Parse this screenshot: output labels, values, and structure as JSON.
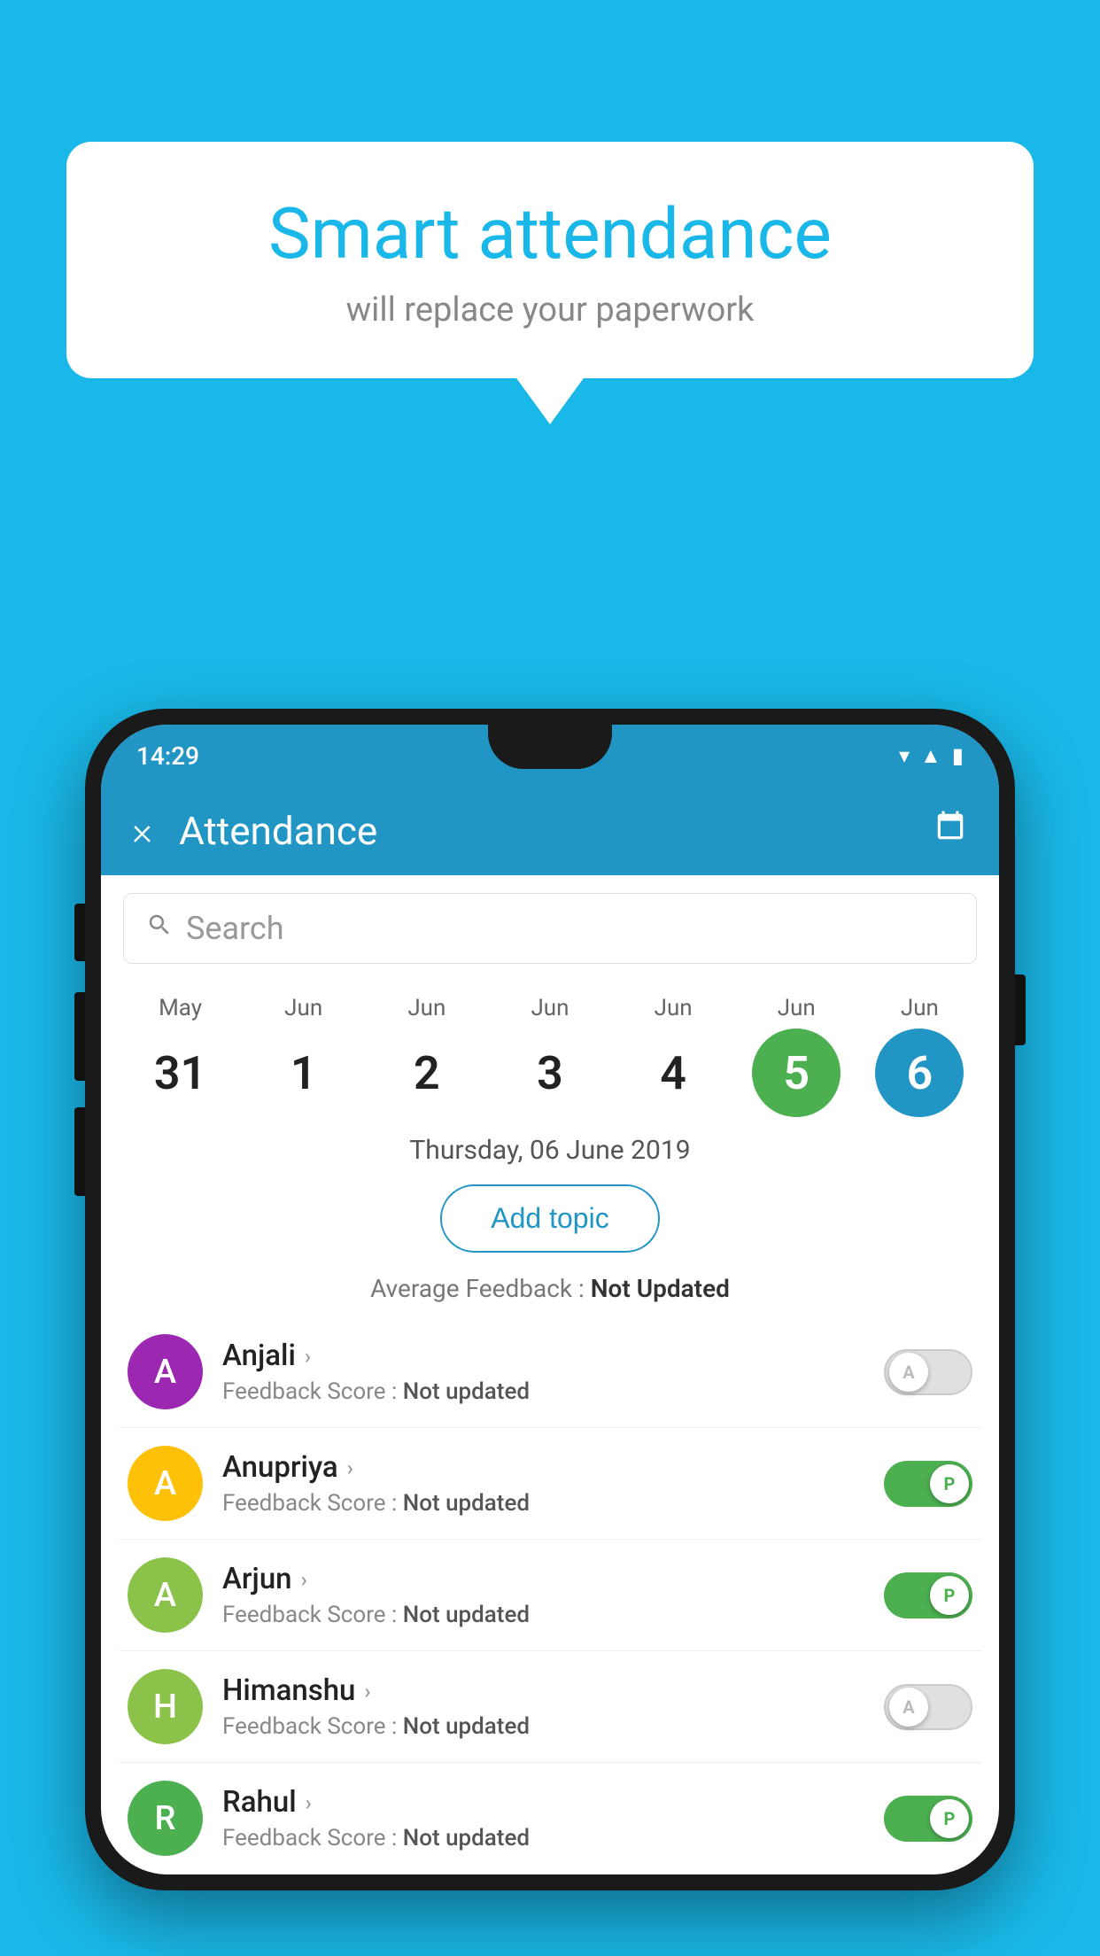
{
  "background_color": "#1ab8e8",
  "bubble": {
    "title": "Smart attendance",
    "subtitle": "will replace your paperwork"
  },
  "status_bar": {
    "time": "14:29",
    "icons": [
      "wifi",
      "signal",
      "battery"
    ]
  },
  "app_bar": {
    "title": "Attendance",
    "close_label": "×",
    "calendar_label": "📅"
  },
  "search": {
    "placeholder": "Search"
  },
  "calendar": {
    "days": [
      {
        "month": "May",
        "date": "31",
        "state": "normal"
      },
      {
        "month": "Jun",
        "date": "1",
        "state": "normal"
      },
      {
        "month": "Jun",
        "date": "2",
        "state": "normal"
      },
      {
        "month": "Jun",
        "date": "3",
        "state": "normal"
      },
      {
        "month": "Jun",
        "date": "4",
        "state": "normal"
      },
      {
        "month": "Jun",
        "date": "5",
        "state": "today"
      },
      {
        "month": "Jun",
        "date": "6",
        "state": "selected"
      }
    ]
  },
  "selected_date_label": "Thursday, 06 June 2019",
  "add_topic_label": "Add topic",
  "avg_feedback_prefix": "Average Feedback : ",
  "avg_feedback_value": "Not Updated",
  "students": [
    {
      "name": "Anjali",
      "avatar_letter": "A",
      "avatar_color": "#9c27b0",
      "feedback_prefix": "Feedback Score : ",
      "feedback_value": "Not updated",
      "toggle_state": "off",
      "toggle_letter": "A"
    },
    {
      "name": "Anupriya",
      "avatar_letter": "A",
      "avatar_color": "#ffc107",
      "feedback_prefix": "Feedback Score : ",
      "feedback_value": "Not updated",
      "toggle_state": "on",
      "toggle_letter": "P"
    },
    {
      "name": "Arjun",
      "avatar_letter": "A",
      "avatar_color": "#8bc34a",
      "feedback_prefix": "Feedback Score : ",
      "feedback_value": "Not updated",
      "toggle_state": "on",
      "toggle_letter": "P"
    },
    {
      "name": "Himanshu",
      "avatar_letter": "H",
      "avatar_color": "#8bc34a",
      "feedback_prefix": "Feedback Score : ",
      "feedback_value": "Not updated",
      "toggle_state": "off",
      "toggle_letter": "A"
    },
    {
      "name": "Rahul",
      "avatar_letter": "R",
      "avatar_color": "#4caf50",
      "feedback_prefix": "Feedback Score : ",
      "feedback_value": "Not updated",
      "toggle_state": "on",
      "toggle_letter": "P"
    }
  ]
}
